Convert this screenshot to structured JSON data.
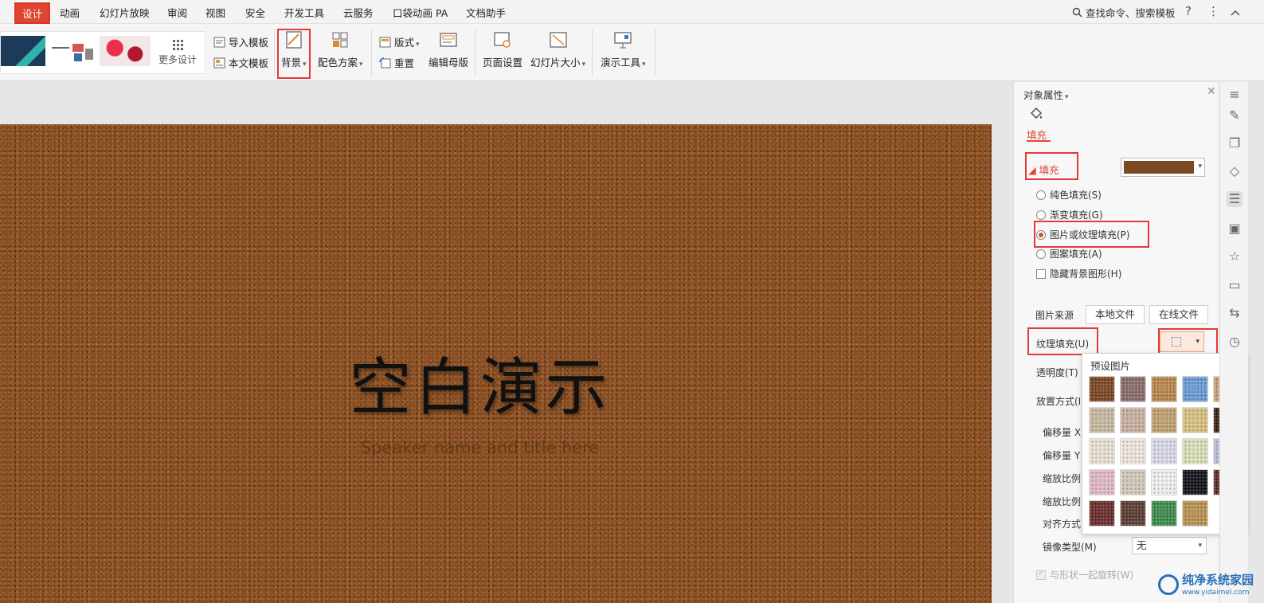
{
  "menu": {
    "items": [
      "设计",
      "动画",
      "幻灯片放映",
      "审阅",
      "视图",
      "安全",
      "开发工具",
      "云服务",
      "口袋动画 PA",
      "文档助手"
    ],
    "search": "查找命令、搜索模板",
    "help": "?",
    "more": "⋮"
  },
  "ribbon": {
    "more_design": "更多设计",
    "import_template": "导入模板",
    "text_template": "本文模板",
    "background": "背景",
    "color_scheme": "配色方案",
    "layout": "版式",
    "reset": "重置",
    "edit_master": "编辑母版",
    "page_setup": "页面设置",
    "slide_size": "幻灯片大小",
    "present_tools": "演示工具"
  },
  "slide": {
    "title": "空白演示",
    "subtitle": "Speaker name and title here"
  },
  "panel": {
    "title": "对象属性",
    "tab_fill": "填充",
    "fill_header": "填充",
    "options": {
      "solid": "纯色填充(S)",
      "gradient": "渐变填充(G)",
      "picture": "图片或纹理填充(P)",
      "pattern": "图案填充(A)",
      "hide_bg": "隐藏背景图形(H)"
    },
    "picture_source": "图片来源",
    "local_file": "本地文件",
    "online_file": "在线文件",
    "texture_fill": "纹理填充(U)",
    "transparency": "透明度(T)",
    "placement": "放置方式(I)",
    "offset_x": "偏移量 X",
    "offset_y": "偏移量 Y",
    "scale_x": "缩放比例",
    "scale_y": "缩放比例",
    "align": "对齐方式(",
    "mirror": "镜像类型(M)",
    "mirror_value": "无",
    "rotate_with_shape": "与形状一起旋转(W)"
  },
  "texture_popup": {
    "header": "预设图片",
    "textures": [
      "#7a4520",
      "#8a6a6a",
      "#b8864a",
      "#6a9ad8",
      "#c8a07a",
      "#c8b8a0",
      "#c8b0a0",
      "#c0a070",
      "#d8c080",
      "#3a2010",
      "#e8e0d0",
      "#f0e4dc",
      "#d8d8e8",
      "#d8e0b8",
      "#b8c0d8",
      "#e0b8c8",
      "#d0c8b8",
      "#f0eeec",
      "#101018",
      "#5a2a20",
      "#6a2a28",
      "#5a3a30",
      "#3a8a48",
      "#b89050"
    ]
  },
  "watermark": {
    "line1": "纯净系统家园",
    "line2": "www.yidaimei.com"
  },
  "colors": {
    "accent": "#e0462f",
    "highlight": "#e23a3a",
    "slide_bg": "#8a4e22"
  }
}
